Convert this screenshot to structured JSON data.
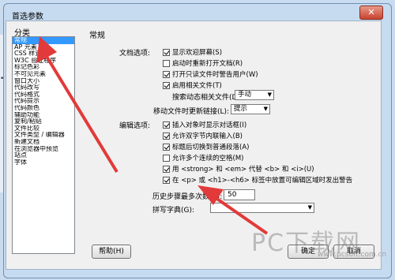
{
  "window": {
    "title": "首选参数",
    "close": "✕"
  },
  "outside": {
    "label": "•标"
  },
  "category": {
    "header": "分类",
    "items": [
      "常规",
      "AP 元素",
      "CSS 样式",
      "W3C 验证程序",
      "标记色彩",
      "不可见元素",
      "窗口大小",
      "代码改写",
      "代码格式",
      "代码提示",
      "代码颜色",
      "辅助功能",
      "复制/粘贴",
      "文件比较",
      "文件类型 / 编辑器",
      "新建文档",
      "在浏览器中预览",
      "站点",
      "字体"
    ],
    "selected_index": 0
  },
  "general": {
    "section_title": "常规",
    "doc_options_label": "文档选项:",
    "doc_opts": [
      {
        "label": "显示欢迎屏幕(S)",
        "checked": true
      },
      {
        "label": "启动时重新打开文档(R)",
        "checked": false
      },
      {
        "label": "打开只读文件时警告用户(W)",
        "checked": true
      },
      {
        "label": "启用相关文件(T)",
        "checked": true
      }
    ],
    "search_dynamic_label": "搜索动态相关文件(D):",
    "search_dynamic_value": "手动",
    "move_file_label": "移动文件时更新链接(L):",
    "move_file_value": "提示",
    "edit_options_label": "编辑选项:",
    "edit_opts": [
      {
        "label": "插入对象时显示对话框(I)",
        "checked": true
      },
      {
        "label": "允许双字节内联输入(B)",
        "checked": true
      },
      {
        "label": "标题后切换到普通段落(A)",
        "checked": true
      },
      {
        "label": "允许多个连续的空格(M)",
        "checked": false
      },
      {
        "label": "用 <strong> 和 <em> 代替 <b> 和 <i>(U)",
        "checked": true
      },
      {
        "label": "在 <p> 或 <h1>-<h6> 标签中放置可编辑区域时发出警告",
        "checked": true
      }
    ],
    "history_label": "历史步骤最多次数(X):",
    "history_value": "50",
    "spell_label": "拼写字典(G):",
    "spell_value": ""
  },
  "buttons": {
    "help": "帮助(H)",
    "ok": "确定",
    "cancel": "取消"
  },
  "watermark": {
    "main": "PC下载网",
    "url": "www.pcsoft.com.cn"
  },
  "colors": {
    "annotation_arrow": "#e23a3a",
    "selection": "#3399ff"
  }
}
